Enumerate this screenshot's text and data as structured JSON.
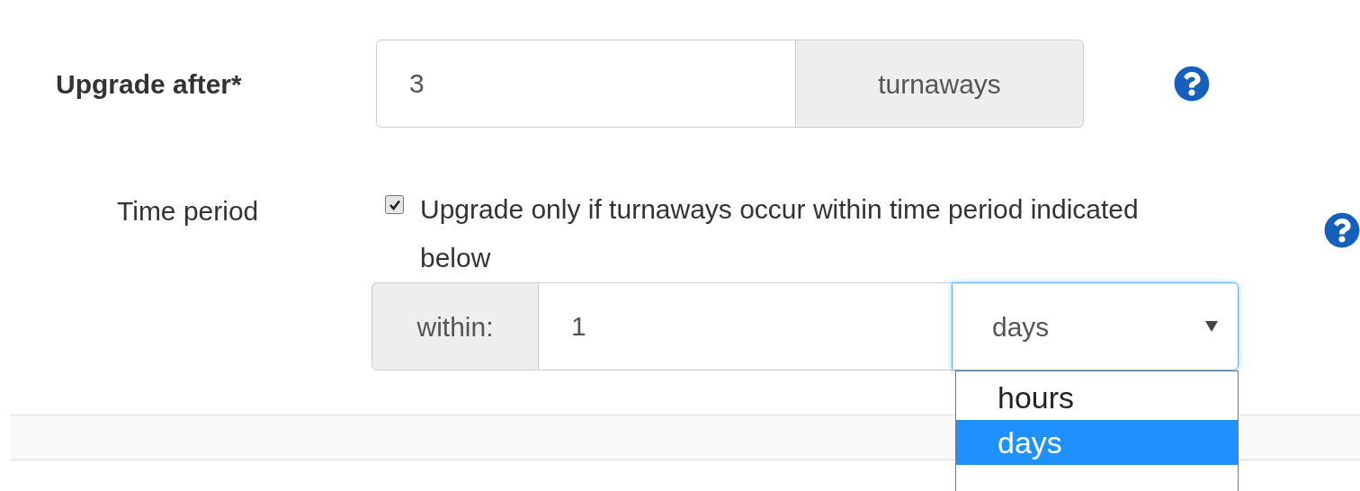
{
  "upgrade_after": {
    "label": "Upgrade after*",
    "value": "3",
    "unit": "turnaways"
  },
  "time_period": {
    "label": "Time period",
    "checkbox": {
      "label": "Upgrade only if turnaways occur within time period indicated below",
      "checked": true
    },
    "within": {
      "prefix": "within:",
      "value": "1",
      "unit": {
        "value": "days",
        "expanded": true,
        "options": [
          {
            "label": "hours",
            "selected": false
          },
          {
            "label": "days",
            "selected": true
          }
        ]
      }
    }
  }
}
